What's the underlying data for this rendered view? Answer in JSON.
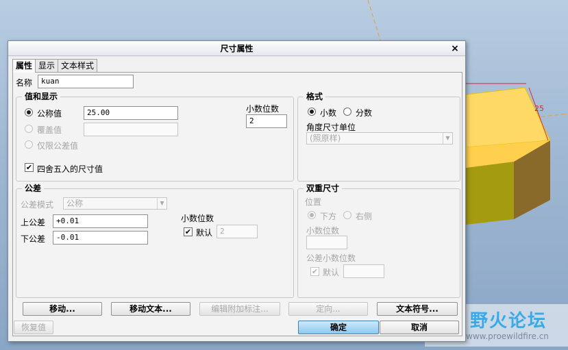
{
  "dialog": {
    "title": "尺寸属性",
    "close_glyph": "×",
    "tabs": [
      {
        "label": "属性",
        "active": true
      },
      {
        "label": "显示",
        "active": false
      },
      {
        "label": "文本样式",
        "active": false
      }
    ],
    "name": {
      "label": "名称",
      "value": "kuan"
    },
    "value_display": {
      "title": "值和显示",
      "nominal": {
        "label": "公称值",
        "value": "25.00",
        "checked": true
      },
      "override": {
        "label": "覆盖值",
        "value": "",
        "checked": false,
        "enabled": false
      },
      "tol_only": {
        "label": "仅限公差值",
        "checked": false,
        "enabled": false
      },
      "decimals": {
        "label": "小数位数",
        "value": "2"
      },
      "round": {
        "label": "四舍五入的尺寸值",
        "checked": true
      }
    },
    "format": {
      "title": "格式",
      "decimal": {
        "label": "小数",
        "checked": true
      },
      "fraction": {
        "label": "分数",
        "checked": false
      },
      "angle_unit": {
        "label": "角度尺寸单位",
        "value": "(照原样)"
      }
    },
    "tolerance": {
      "title": "公差",
      "mode": {
        "label": "公差模式",
        "value": "公称"
      },
      "upper": {
        "label": "上公差",
        "value": "+0.01"
      },
      "lower": {
        "label": "下公差",
        "value": "-0.01"
      },
      "decimals": {
        "label": "小数位数",
        "default_label": "默认",
        "default_checked": true,
        "value": "2"
      }
    },
    "dual": {
      "title": "双重尺寸",
      "position": {
        "label": "位置",
        "below": "下方",
        "right": "右侧"
      },
      "decimals": {
        "label": "小数位数",
        "value": ""
      },
      "tol_decimals": {
        "label": "公差小数位数",
        "default_label": "默认",
        "default_checked": true,
        "value": ""
      }
    },
    "buttons": {
      "move": "移动...",
      "move_text": "移动文本...",
      "edit_attached_notes": "编辑附加标注...",
      "orient": "定向...",
      "text_symbol": "文本符号...",
      "restore": "恢复值",
      "ok": "确定",
      "cancel": "取消"
    }
  },
  "model": {
    "dimension_label": "25"
  },
  "watermark": {
    "brand": "野火论坛",
    "url": "www.proewildfire.cn"
  },
  "colors": {
    "accent": "#3c7fb1",
    "box_top": "#ffd966",
    "box_side": "#8a6a2a",
    "box_front": "#a49b10",
    "dimension": "#d62828",
    "centerline": "#e89b3a"
  }
}
